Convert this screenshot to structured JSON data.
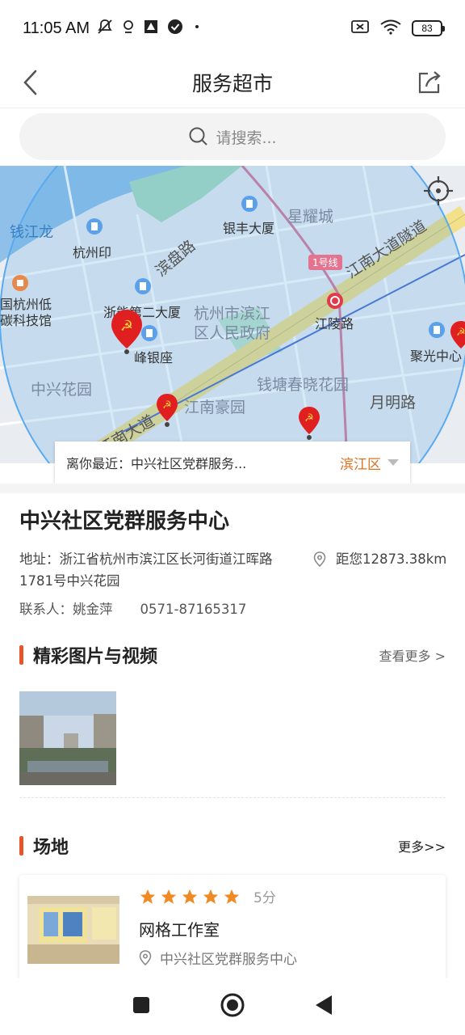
{
  "status_bar": {
    "time": "11:05 AM",
    "battery": "83",
    "icons": [
      "mute-icon",
      "location-icon",
      "app-icon",
      "check-icon",
      "dot-icon",
      "sim-icon",
      "wifi-icon",
      "battery-icon"
    ]
  },
  "header": {
    "title": "服务超市",
    "back_icon": "chevron-left-icon",
    "share_icon": "share-icon"
  },
  "search": {
    "placeholder": "请搜索..."
  },
  "map": {
    "labels": {
      "qianjianglong": "钱江龙",
      "hangzhouyin": "杭州印",
      "binpanlu": "滨盘路",
      "yinfeng": "银丰大厦",
      "xingyao": "星耀城",
      "line1": "1号线",
      "jiangnan_tunnel": "江南大道隧道",
      "guohang": "国杭州低",
      "tankeji": "碳科技馆",
      "zheneng": "浙能第二大厦",
      "gov1": "杭州市滨江",
      "gov2": "区人民政府",
      "jianglinglu": "江陵路",
      "juguang": "聚光中心",
      "fengyin": "峰银座",
      "zhongxing_garden": "中兴花园",
      "qiantang": "钱塘春晓花园",
      "yueminglu": "月明路",
      "jiangnanhao": "江南豪园",
      "jiangnanda": "江南大道"
    },
    "nearest_label": "离你最近：中兴社区党群服务...",
    "district": "滨江区"
  },
  "place": {
    "title": "中兴社区党群服务中心",
    "address": "地址：浙江省杭州市滨江区长河街道江晖路1781号中兴花园",
    "distance": "距您12873.38km",
    "contact_label": "联系人：姚金萍",
    "phone": "0571-87165317"
  },
  "media_section": {
    "title": "精彩图片与视频",
    "more": "查看更多 >"
  },
  "venue_section": {
    "title": "场地",
    "more": "更多>>",
    "items": [
      {
        "rating": 5,
        "score_label": "5分",
        "name": "网格工作室",
        "location": "中兴社区党群服务中心"
      }
    ]
  },
  "colors": {
    "accent": "#e8552a",
    "district": "#e07020",
    "star": "#f08a24",
    "pin_red": "#e02020"
  }
}
